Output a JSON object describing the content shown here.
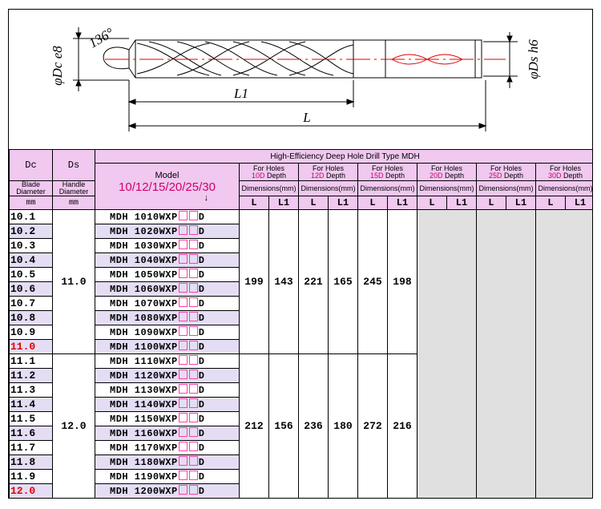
{
  "drawing": {
    "angle": "136°",
    "dc_label": "φDc e8",
    "ds_label": "φDs h6",
    "l1_label": "L1",
    "l_label": "L"
  },
  "table": {
    "title": "High-Efficiency Deep Hole Drill Type MDH",
    "col_dc": "Dc",
    "col_ds": "Ds",
    "blade_line1": "Blade",
    "blade_line2": "Diameter",
    "handle_line1": "Handle",
    "handle_line2": "Diameter",
    "unit_dc": "mm",
    "unit_ds": "mm",
    "model_label": "Model",
    "model_series": "10/12/15/20/25/30",
    "model_arrow": "↓",
    "depth_prefix": "For Holes",
    "depth_suffix": "Depth",
    "depths": [
      "10D",
      "12D",
      "15D",
      "20D",
      "25D",
      "30D"
    ],
    "dim_label": "Dimensions(mm)",
    "l_head": "L",
    "l1_head": "L1",
    "groups": [
      {
        "ds": "11.0",
        "dims": [
          "199",
          "143",
          "221",
          "165",
          "245",
          "198"
        ],
        "rows": [
          {
            "dc": "10.1",
            "model": "MDH 1010WXP",
            "suffix": "D"
          },
          {
            "dc": "10.2",
            "model": "MDH 1020WXP",
            "suffix": "D"
          },
          {
            "dc": "10.3",
            "model": "MDH 1030WXP",
            "suffix": "D"
          },
          {
            "dc": "10.4",
            "model": "MDH 1040WXP",
            "suffix": "D"
          },
          {
            "dc": "10.5",
            "model": "MDH 1050WXP",
            "suffix": "D"
          },
          {
            "dc": "10.6",
            "model": "MDH 1060WXP",
            "suffix": "D"
          },
          {
            "dc": "10.7",
            "model": "MDH 1070WXP",
            "suffix": "D"
          },
          {
            "dc": "10.8",
            "model": "MDH 1080WXP",
            "suffix": "D"
          },
          {
            "dc": "10.9",
            "model": "MDH 1090WXP",
            "suffix": "D"
          },
          {
            "dc": "11.0",
            "model": "MDH 1100WXP",
            "suffix": "D"
          }
        ]
      },
      {
        "ds": "12.0",
        "dims": [
          "212",
          "156",
          "236",
          "180",
          "272",
          "216"
        ],
        "rows": [
          {
            "dc": "11.1",
            "model": "MDH 1110WXP",
            "suffix": "D"
          },
          {
            "dc": "11.2",
            "model": "MDH 1120WXP",
            "suffix": "D"
          },
          {
            "dc": "11.3",
            "model": "MDH 1130WXP",
            "suffix": "D"
          },
          {
            "dc": "11.4",
            "model": "MDH 1140WXP",
            "suffix": "D"
          },
          {
            "dc": "11.5",
            "model": "MDH 1150WXP",
            "suffix": "D"
          },
          {
            "dc": "11.6",
            "model": "MDH 1160WXP",
            "suffix": "D"
          },
          {
            "dc": "11.7",
            "model": "MDH 1170WXP",
            "suffix": "D"
          },
          {
            "dc": "11.8",
            "model": "MDH 1180WXP",
            "suffix": "D"
          },
          {
            "dc": "11.9",
            "model": "MDH 1190WXP",
            "suffix": "D"
          },
          {
            "dc": "12.0",
            "model": "MDH 1200WXP",
            "suffix": "D"
          }
        ]
      }
    ],
    "colors": {
      "header": "#f0c8f0",
      "alt_row": "#e4ddf4",
      "highlight": "#e00000",
      "depth_num": "#d0006a",
      "unavailable": "#e0e0e0"
    }
  }
}
